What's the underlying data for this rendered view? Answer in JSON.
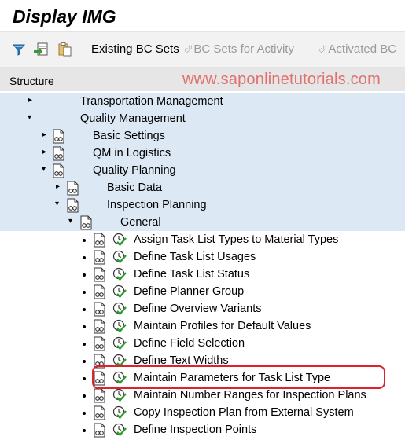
{
  "window": {
    "title": "Display IMG"
  },
  "toolbar": {
    "existing_bc_sets": "Existing BC Sets",
    "bc_sets_for_activity": "BC Sets for Activity",
    "activated_bc": "Activated BC"
  },
  "structure": {
    "header_label": "Structure",
    "watermark": "www.saponlinetutorials.com"
  },
  "tree": {
    "transportation_management": "Transportation Management",
    "quality_management": "Quality Management",
    "basic_settings": "Basic Settings",
    "qm_in_logistics": "QM in Logistics",
    "quality_planning": "Quality Planning",
    "basic_data": "Basic Data",
    "inspection_planning": "Inspection Planning",
    "general": "General",
    "activities": [
      "Assign Task List Types to Material Types",
      "Define Task List Usages",
      "Define Task List Status",
      "Define Planner Group",
      "Define Overview Variants",
      "Maintain Profiles for Default Values",
      "Define Field Selection",
      "Define Text Widths",
      "Maintain Parameters for Task List Type",
      "Maintain Number Ranges for Inspection Plans",
      "Copy Inspection Plan from External System",
      "Define Inspection Points"
    ],
    "highlighted_activity": "Maintain Parameters for Task List Type"
  },
  "colors": {
    "tree_shade": "#dce8f4",
    "highlight_border": "#e0202a",
    "watermark": "#e07070"
  }
}
